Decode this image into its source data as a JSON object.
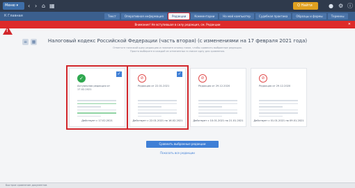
{
  "topbar": {
    "menu_label": "Меню ▾",
    "search_label": "Q Найти"
  },
  "tabbar": {
    "logo": "К Главная",
    "tabs": [
      {
        "label": "Текст",
        "active": false
      },
      {
        "label": "Оперативная информация",
        "active": false
      },
      {
        "label": "Редакции",
        "active": true
      },
      {
        "label": "Комментарии",
        "active": false
      },
      {
        "label": "На мой компьютер",
        "active": false
      },
      {
        "label": "Судебная практика",
        "active": false
      },
      {
        "label": "Образцы и формы",
        "active": false
      },
      {
        "label": "Термины",
        "active": false
      }
    ]
  },
  "alert": {
    "text": "Внимание! Не вступившая в силу редакция, см. Редакции"
  },
  "main": {
    "title": "Налоговый кодекс Российской Федерации (часть вторая) (с изменениями на 17 февраля 2021 года)",
    "subtitle_1": "Отметьте галочкой одну редакцию и нажмите кнопку ниже, чтобы сравнить выбранные редакции.",
    "subtitle_2": "Просто выберите в каждой из отмеченных в списке одну для сравнения.",
    "cards": [
      {
        "status": "ok",
        "label": "Актуальная редакция от 17.02.2021",
        "checked": true,
        "footer": "Действует с 17.02.2021",
        "selected": true
      },
      {
        "status": "no",
        "label": "Редакция от 22.01.2021",
        "checked": true,
        "footer": "Действует с 22.01.2021 по 16.02.2021",
        "selected": true
      },
      {
        "status": "no",
        "label": "Редакция от 29.12.2020",
        "checked": false,
        "footer": "Действует с 10.01.2021 по 21.01.2021",
        "selected": false
      },
      {
        "status": "no",
        "label": "Редакция от 29.12.2020",
        "checked": false,
        "footer": "Действует с 01.01.2021 по 09.01.2021",
        "selected": false
      }
    ],
    "apply_button": "Сравнить выбранные редакции",
    "show_link": "Показать все редакции"
  },
  "statusbar": {
    "text": "Быстрое сравнение документов"
  },
  "colors": {
    "accent": "#3f7fd6",
    "alert": "#dd2a2a",
    "topbar": "#2f3a4c"
  }
}
